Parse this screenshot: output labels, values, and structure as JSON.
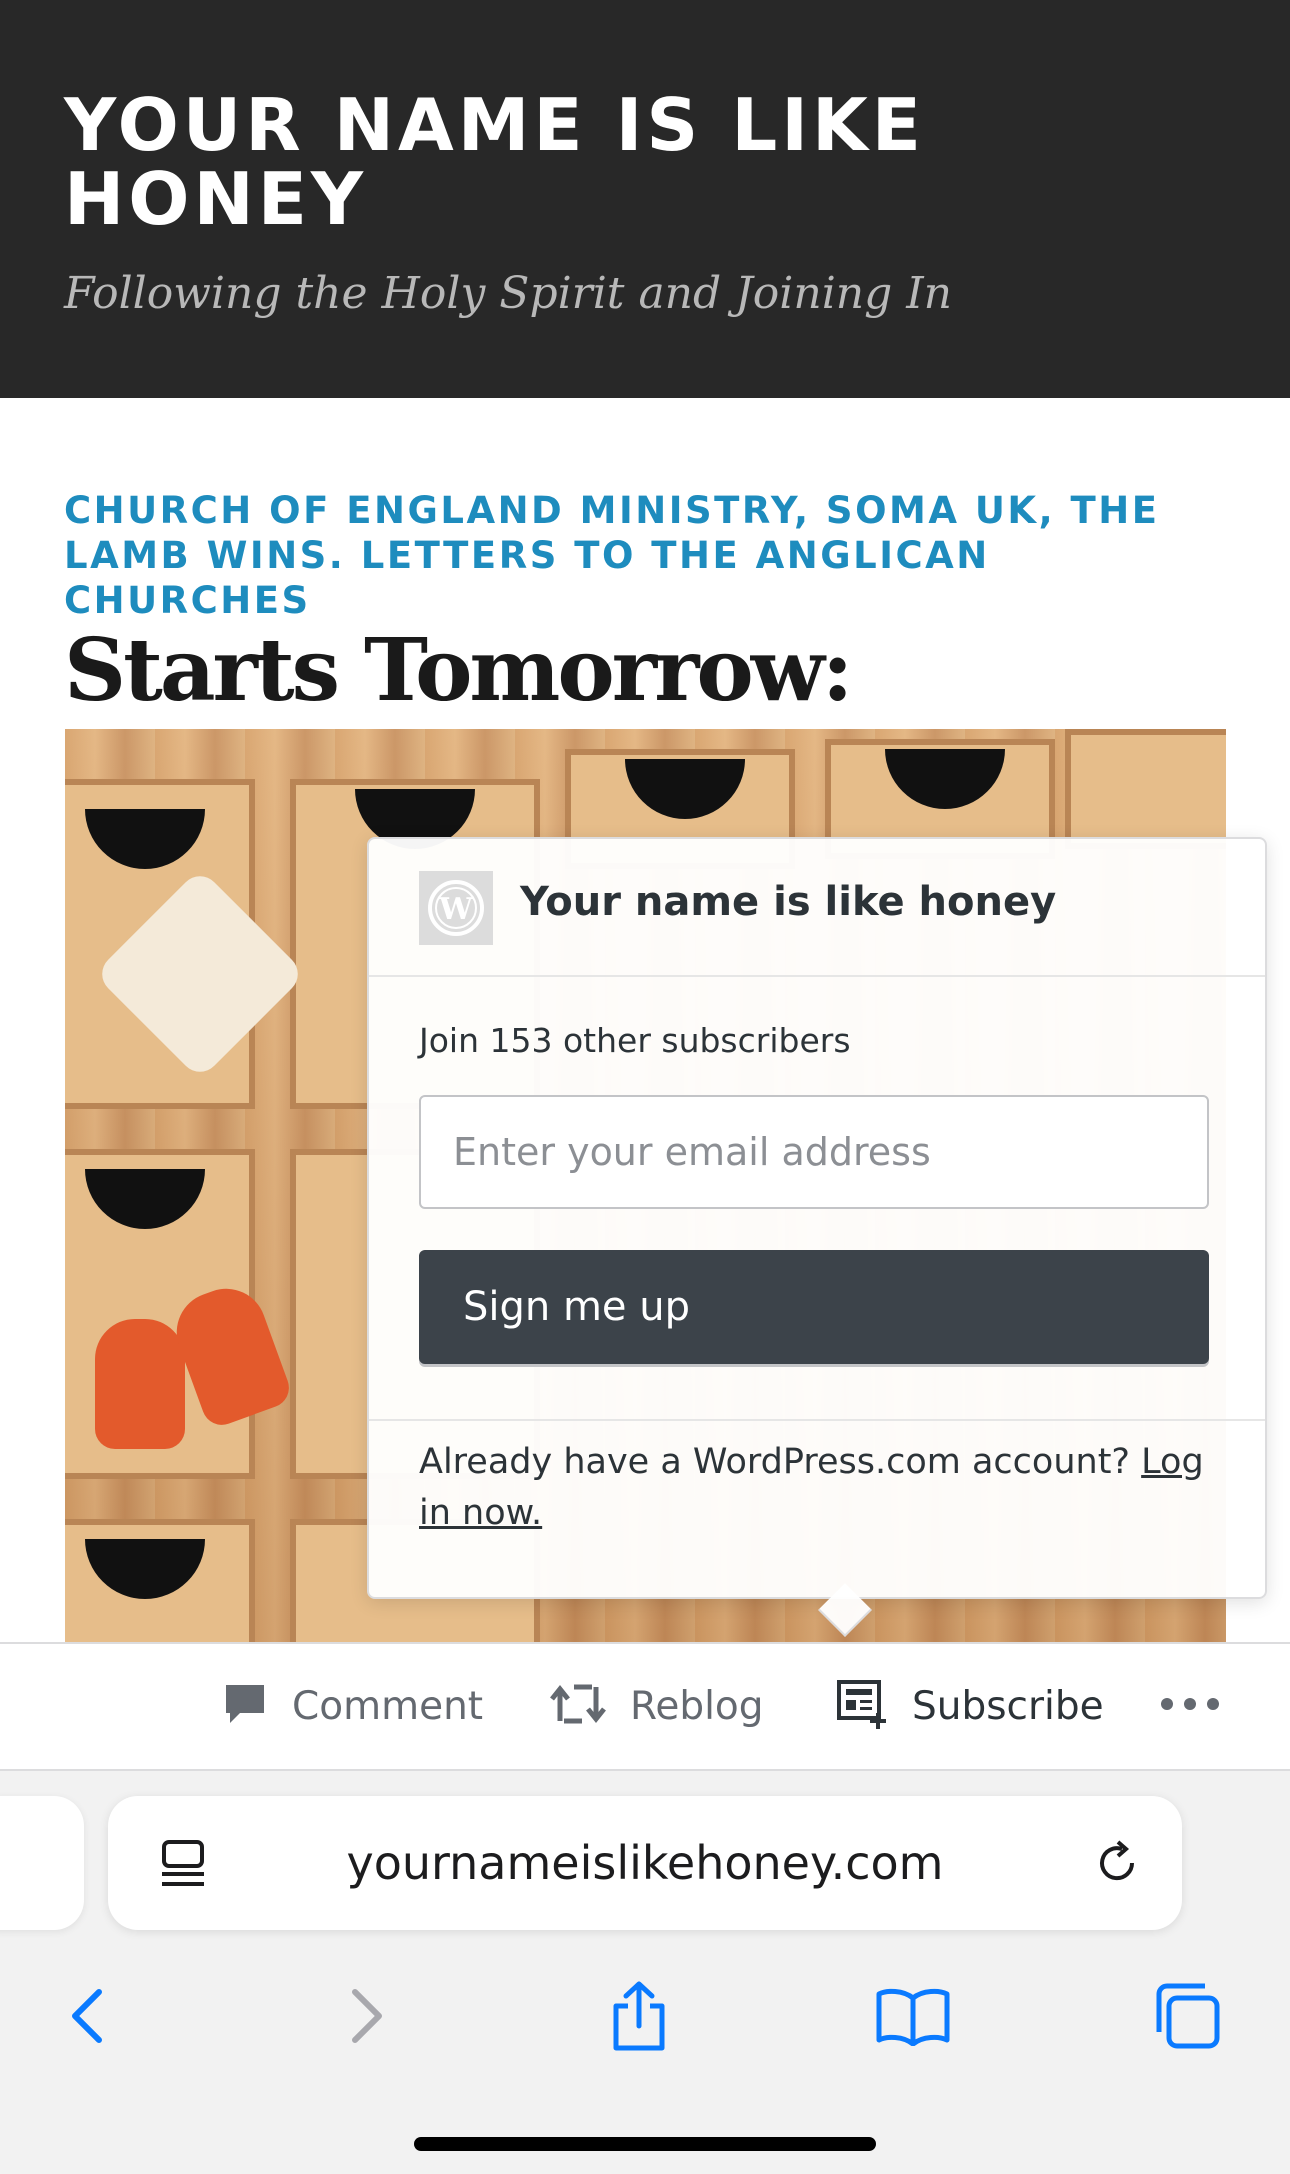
{
  "site": {
    "title": "YOUR NAME IS LIKE HONEY",
    "tagline": "Following the Holy Spirit and Joining In"
  },
  "post": {
    "categories": "CHURCH OF ENGLAND MINISTRY, SOMA UK, THE LAMB WINS. LETTERS TO THE ANGLICAN CHURCHES",
    "title": "Starts Tomorrow:"
  },
  "subscribe_popup": {
    "blog_name": "Your name is like honey",
    "join_text": "Join 153 other subscribers",
    "email_placeholder": "Enter your email address",
    "signup_label": "Sign me up",
    "already_text": "Already have a WordPress.com account?",
    "login_link": "Log in now."
  },
  "action_bar": {
    "comment": "Comment",
    "reblog": "Reblog",
    "subscribe": "Subscribe",
    "more_icon": "ellipsis-icon"
  },
  "browser": {
    "url": "yournameislikehoney.com",
    "accent_color": "#0a7aff"
  },
  "colors": {
    "header_bg": "#282828",
    "category_link": "#1e8cbe",
    "signup_button": "#3c434a"
  }
}
